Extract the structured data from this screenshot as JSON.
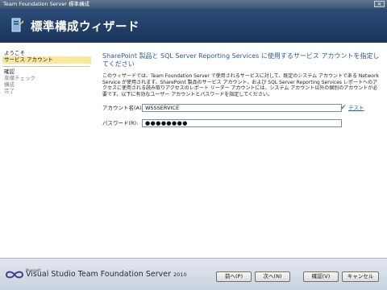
{
  "window": {
    "title": "Team Foundation Server 標準構成",
    "close_glyph": "×"
  },
  "header": {
    "title": "標準構成ウィザード",
    "icon": "wizard-icon"
  },
  "sidebar": {
    "items": [
      {
        "label": "ようこそ"
      },
      {
        "label": "サービス アカウント"
      },
      {
        "label": "確認"
      },
      {
        "label": "準備チェック"
      },
      {
        "label": "構成"
      },
      {
        "label": "完了"
      }
    ]
  },
  "main": {
    "heading": "SharePoint 製品と SQL Server Reporting Services に使用するサービス アカウントを指定してください",
    "description": "このウィザードでは、Team Foundation Server で使用されるサービスに対して、既定のシステム アカウントである Network Service が使用されます。SharePoint 製品のサービス アカウント、および SQL Server Reporting Services レポートへのアクセスに使用される読み取りアクセスのレポート リーダー アカウントには、システム アカウント以外の個別のアカウントが必要です。以下に有効なユーザー アカウントとパスワードを指定してください。",
    "account_label": "アカウント名(A):",
    "account_value": "WSSSERVICE",
    "password_label": "パスワード(R):",
    "password_value": "●●●●●●●●",
    "test_link": "テスト",
    "test_icon": "checkmark-icon"
  },
  "footer": {
    "logo_brand": "Microsoft",
    "logo_text": "Visual Studio Team Foundation Server",
    "logo_year": "2010",
    "buttons": {
      "prev": "前へ(P)",
      "next": "次へ(N)",
      "verify": "確認(V)",
      "cancel": "キャンセル"
    }
  },
  "colors": {
    "header": "#1f3d66",
    "accent": "#2c5d96",
    "active_item": "#f8e79d"
  }
}
